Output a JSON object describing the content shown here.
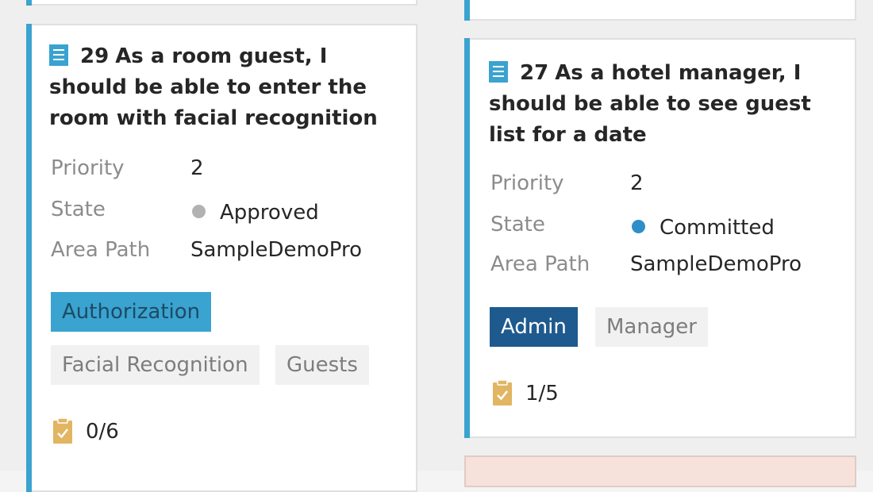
{
  "colors": {
    "accent": "#3aa3cf",
    "approved": "#b2b2b2",
    "committed": "#2f8ec8",
    "tag_authorization": "#3aa3cf",
    "tag_admin": "#1f5a8f",
    "tag_plain": "#f1f1f1",
    "checklist_icon": "#e1b562",
    "below_card_fill": "#f7e1db"
  },
  "cards": [
    {
      "id": "29",
      "title": "As a room guest, I should be able to enter the room with facial recognition",
      "icon": "work-item-icon",
      "fields": {
        "priority_label": "Priority",
        "priority_value": "2",
        "state_label": "State",
        "state_value": "Approved",
        "area_path_label": "Area Path",
        "area_path_value": "SampleDemoPro"
      },
      "tags": [
        "Authorization",
        "Facial Recognition",
        "Guests"
      ],
      "checklist": {
        "icon": "checklist-icon",
        "value": "0/6"
      }
    },
    {
      "id": "27",
      "title": "As a hotel manager, I should be able to see guest list for a date",
      "icon": "work-item-icon",
      "fields": {
        "priority_label": "Priority",
        "priority_value": "2",
        "state_label": "State",
        "state_value": "Committed",
        "area_path_label": "Area Path",
        "area_path_value": "SampleDemoPro"
      },
      "tags": [
        "Admin",
        "Manager"
      ],
      "checklist": {
        "icon": "checklist-icon",
        "value": "1/5"
      }
    }
  ]
}
